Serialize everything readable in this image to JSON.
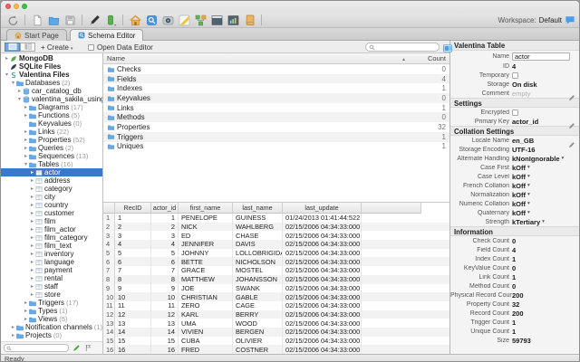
{
  "colors": {
    "selection_blue": "#3e76c9",
    "accent_blue": "#4a90d9",
    "folder_blue": "#5fa8e8"
  },
  "toolbar": {
    "items": [
      "undo",
      "sep",
      "new-document",
      "open-folder",
      "save",
      "sep",
      "pen",
      "column-green",
      "sep",
      "home",
      "schema-editor",
      "data-editor",
      "sql-editor",
      "diagram",
      "window",
      "report",
      "book",
      "sep"
    ],
    "workspace_label": "Workspace:",
    "workspace_value": "Default"
  },
  "tabs": [
    {
      "label": "Start Page",
      "icon": "home",
      "active": false
    },
    {
      "label": "Schema Editor",
      "icon": "schema-editor",
      "active": true
    }
  ],
  "subtoolbar": {
    "create_label": "+ Create",
    "open_data_editor_label": "Open Data Editor"
  },
  "sidebar": {
    "tree": [
      {
        "label": "MongoDB",
        "level": 0,
        "icon": "leaf",
        "chevron": "closed",
        "bold": true
      },
      {
        "label": "SQLite Files",
        "level": 0,
        "icon": "feather",
        "chevron": "none",
        "bold": true
      },
      {
        "label": "Valentina Files",
        "level": 0,
        "icon": "valentina",
        "chevron": "open",
        "bold": true
      },
      {
        "label": "Databases",
        "count": "(2)",
        "level": 1,
        "icon": "folder",
        "chevron": "open"
      },
      {
        "label": "car_catalog_db",
        "level": 2,
        "icon": "database",
        "chevron": "closed"
      },
      {
        "label": "valentina_sakila_using_fo...",
        "level": 2,
        "icon": "database",
        "chevron": "open"
      },
      {
        "label": "Diagrams",
        "count": "(17)",
        "level": 3,
        "icon": "folder",
        "chevron": "closed"
      },
      {
        "label": "Functions",
        "count": "(5)",
        "level": 3,
        "icon": "folder",
        "chevron": "closed"
      },
      {
        "label": "Keyvalues",
        "count": "(0)",
        "level": 3,
        "icon": "folder",
        "chevron": "none"
      },
      {
        "label": "Links",
        "count": "(22)",
        "level": 3,
        "icon": "folder",
        "chevron": "closed"
      },
      {
        "label": "Properties",
        "count": "(52)",
        "level": 3,
        "icon": "folder",
        "chevron": "closed"
      },
      {
        "label": "Queries",
        "count": "(2)",
        "level": 3,
        "icon": "folder",
        "chevron": "closed"
      },
      {
        "label": "Sequences",
        "count": "(13)",
        "level": 3,
        "icon": "folder",
        "chevron": "closed"
      },
      {
        "label": "Tables",
        "count": "(16)",
        "level": 3,
        "icon": "folder",
        "chevron": "open"
      },
      {
        "label": "actor",
        "level": 4,
        "icon": "table",
        "chevron": "closed",
        "selected": true
      },
      {
        "label": "address",
        "level": 4,
        "icon": "table",
        "chevron": "closed"
      },
      {
        "label": "category",
        "level": 4,
        "icon": "table",
        "chevron": "closed"
      },
      {
        "label": "city",
        "level": 4,
        "icon": "table",
        "chevron": "closed"
      },
      {
        "label": "country",
        "level": 4,
        "icon": "table",
        "chevron": "closed"
      },
      {
        "label": "customer",
        "level": 4,
        "icon": "table",
        "chevron": "closed"
      },
      {
        "label": "film",
        "level": 4,
        "icon": "table",
        "chevron": "closed"
      },
      {
        "label": "film_actor",
        "level": 4,
        "icon": "table",
        "chevron": "closed"
      },
      {
        "label": "film_category",
        "level": 4,
        "icon": "table",
        "chevron": "closed"
      },
      {
        "label": "film_text",
        "level": 4,
        "icon": "table",
        "chevron": "closed"
      },
      {
        "label": "inventory",
        "level": 4,
        "icon": "table",
        "chevron": "closed"
      },
      {
        "label": "language",
        "level": 4,
        "icon": "table",
        "chevron": "closed"
      },
      {
        "label": "payment",
        "level": 4,
        "icon": "table",
        "chevron": "closed"
      },
      {
        "label": "rental",
        "level": 4,
        "icon": "table",
        "chevron": "closed"
      },
      {
        "label": "staff",
        "level": 4,
        "icon": "table",
        "chevron": "closed"
      },
      {
        "label": "store",
        "level": 4,
        "icon": "table",
        "chevron": "closed"
      },
      {
        "label": "Triggers",
        "count": "(17)",
        "level": 3,
        "icon": "folder",
        "chevron": "closed"
      },
      {
        "label": "Types",
        "count": "(1)",
        "level": 3,
        "icon": "folder",
        "chevron": "closed"
      },
      {
        "label": "Views",
        "count": "(5)",
        "level": 3,
        "icon": "folder",
        "chevron": "closed"
      },
      {
        "label": "Notification channels",
        "count": "(1)",
        "level": 1,
        "icon": "folder",
        "chevron": "closed"
      },
      {
        "label": "Projects",
        "count": "(0)",
        "level": 1,
        "icon": "folder",
        "chevron": "closed"
      }
    ]
  },
  "schema_list": {
    "name_header": "Name",
    "count_header": "Count",
    "items": [
      {
        "name": "Checks",
        "count": "0"
      },
      {
        "name": "Fields",
        "count": "4"
      },
      {
        "name": "Indexes",
        "count": "1"
      },
      {
        "name": "Keyvalues",
        "count": "0"
      },
      {
        "name": "Links",
        "count": "1"
      },
      {
        "name": "Methods",
        "count": "0"
      },
      {
        "name": "Properties",
        "count": "32"
      },
      {
        "name": "Triggers",
        "count": "1"
      },
      {
        "name": "Uniques",
        "count": "1"
      }
    ]
  },
  "data_grid": {
    "columns": [
      "RecID",
      "actor_id",
      "first_name",
      "last_name",
      "last_update"
    ],
    "rows": [
      [
        "1",
        "1",
        "1",
        "PENELOPE",
        "GUINESS",
        "01/24/2013 01:41:44:522"
      ],
      [
        "2",
        "2",
        "2",
        "NICK",
        "WAHLBERG",
        "02/15/2006 04:34:33:000"
      ],
      [
        "3",
        "3",
        "3",
        "ED",
        "CHASE",
        "02/15/2006 04:34:33:000"
      ],
      [
        "4",
        "4",
        "4",
        "JENNIFER",
        "DAVIS",
        "02/15/2006 04:34:33:000"
      ],
      [
        "5",
        "5",
        "5",
        "JOHNNY",
        "LOLLOBRIGIDA",
        "02/15/2006 04:34:33:000"
      ],
      [
        "6",
        "6",
        "6",
        "BETTE",
        "NICHOLSON",
        "02/15/2006 04:34:33:000"
      ],
      [
        "7",
        "7",
        "7",
        "GRACE",
        "MOSTEL",
        "02/15/2006 04:34:33:000"
      ],
      [
        "8",
        "8",
        "8",
        "MATTHEW",
        "JOHANSSON",
        "02/15/2006 04:34:33:000"
      ],
      [
        "9",
        "9",
        "9",
        "JOE",
        "SWANK",
        "02/15/2006 04:34:33:000"
      ],
      [
        "10",
        "10",
        "10",
        "CHRISTIAN",
        "GABLE",
        "02/15/2006 04:34:33:000"
      ],
      [
        "11",
        "11",
        "11",
        "ZERO",
        "CAGE",
        "02/15/2006 04:34:33:000"
      ],
      [
        "12",
        "12",
        "12",
        "KARL",
        "BERRY",
        "02/15/2006 04:34:33:000"
      ],
      [
        "13",
        "13",
        "13",
        "UMA",
        "WOOD",
        "02/15/2006 04:34:33:000"
      ],
      [
        "14",
        "14",
        "14",
        "VIVIEN",
        "BERGEN",
        "02/15/2006 04:34:33:000"
      ],
      [
        "15",
        "15",
        "15",
        "CUBA",
        "OLIVIER",
        "02/15/2006 04:34:33:000"
      ],
      [
        "16",
        "16",
        "16",
        "FRED",
        "COSTNER",
        "02/15/2006 04:34:33:000"
      ]
    ]
  },
  "right_panel": {
    "sections": [
      {
        "title": "Valentina Table",
        "rows": [
          {
            "label": "Name",
            "value": "actor",
            "type": "input"
          },
          {
            "label": "ID",
            "value": "4"
          },
          {
            "label": "Temporary",
            "type": "checkbox"
          },
          {
            "label": "Storage",
            "value": "On disk"
          },
          {
            "label": "Comment",
            "value": "empty",
            "muted": true,
            "pencil": true
          }
        ]
      },
      {
        "title": "Settings",
        "rows": [
          {
            "label": "Encrypted",
            "type": "checkbox"
          },
          {
            "label": "Primary Key",
            "value": "actor_id",
            "pencil": true
          }
        ]
      },
      {
        "title": "Collation Settings",
        "rows": [
          {
            "label": "Locale Name",
            "value": "en_GB",
            "pencil": true
          },
          {
            "label": "Storage Encoding",
            "value": "UTF-16"
          },
          {
            "label": "Alternate Handling",
            "value": "kNonIgnorable",
            "dropdown": true
          },
          {
            "label": "Case First",
            "value": "kOff",
            "dropdown": true
          },
          {
            "label": "Case Level",
            "value": "kOff",
            "dropdown": true
          },
          {
            "label": "French Collation",
            "value": "kOff",
            "dropdown": true
          },
          {
            "label": "Normalization",
            "value": "kOff",
            "dropdown": true
          },
          {
            "label": "Numeric Collation",
            "value": "kOff",
            "dropdown": true
          },
          {
            "label": "Quaternary",
            "value": "kOff",
            "dropdown": true
          },
          {
            "label": "Strength",
            "value": "kTertiary",
            "dropdown": true
          }
        ]
      },
      {
        "title": "Information",
        "rows": [
          {
            "label": "Check Count",
            "value": "0"
          },
          {
            "label": "Field Count",
            "value": "4"
          },
          {
            "label": "Index Count",
            "value": "1"
          },
          {
            "label": "KeyValue Count",
            "value": "0"
          },
          {
            "label": "Link Count",
            "value": "1"
          },
          {
            "label": "Method Count",
            "value": "0"
          },
          {
            "label": "Physical Record Count",
            "value": "200"
          },
          {
            "label": "Property Count",
            "value": "32"
          },
          {
            "label": "Record Count",
            "value": "200"
          },
          {
            "label": "Trigger Count",
            "value": "1"
          },
          {
            "label": "Unique Count",
            "value": "1"
          },
          {
            "label": "Size",
            "value": "59793"
          }
        ]
      }
    ]
  },
  "status_bar": {
    "text": "Ready"
  }
}
